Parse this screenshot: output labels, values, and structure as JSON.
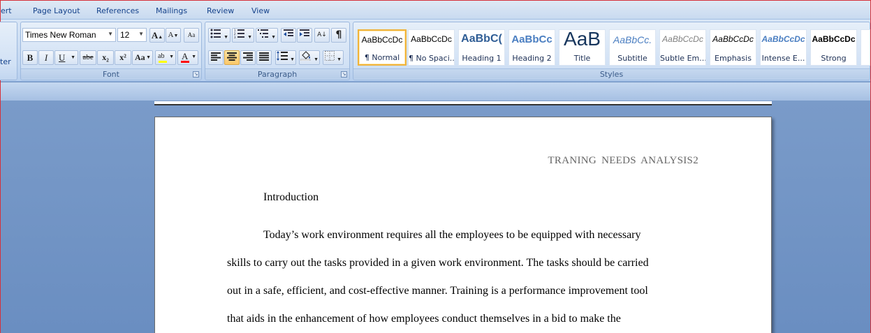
{
  "tabs": [
    "ert",
    "Page Layout",
    "References",
    "Mailings",
    "Review",
    "View"
  ],
  "clipboard_partial_label": "ter",
  "font": {
    "name": "Times New Roman",
    "size": "12",
    "group_label": "Font",
    "buttons": {
      "grow": "A",
      "shrink": "A",
      "clear": "Aa",
      "bold": "B",
      "italic": "I",
      "underline": "U",
      "strike": "abe",
      "subscript": "x₂",
      "superscript": "x²",
      "change_case": "Aa",
      "highlight": "ab",
      "font_color": "A"
    },
    "highlight_color": "#ffff00",
    "font_color_value": "#ff0000"
  },
  "paragraph": {
    "group_label": "Paragraph",
    "pilcrow": "¶",
    "sort": "A↓"
  },
  "styles": {
    "group_label": "Styles",
    "items": [
      {
        "sample": "AaBbCcDc",
        "name": "¶ Normal"
      },
      {
        "sample": "AaBbCcDc",
        "name": "¶ No Spaci..."
      },
      {
        "sample": "AaBbC(",
        "name": "Heading 1"
      },
      {
        "sample": "AaBbCc",
        "name": "Heading 2"
      },
      {
        "sample": "AaB",
        "name": "Title"
      },
      {
        "sample": "AaBbCc.",
        "name": "Subtitle"
      },
      {
        "sample": "AaBbCcDc",
        "name": "Subtle Em..."
      },
      {
        "sample": "AaBbCcDc",
        "name": "Emphasis"
      },
      {
        "sample": "AaBbCcDc",
        "name": "Intense E..."
      },
      {
        "sample": "AaBbCcDc",
        "name": "Strong"
      }
    ]
  },
  "document": {
    "header": "TRANING NEEDS ANALYSIS2",
    "heading": "Introduction",
    "lines": [
      "Today’s work environment requires all the employees to be equipped with necessary",
      "skills to carry out the tasks provided in a given work environment. The tasks should be carried",
      "out in a safe, efficient, and cost-effective manner. Training is a performance improvement tool",
      "that aids in the enhancement of how employees conduct themselves in a bid to make the"
    ]
  }
}
